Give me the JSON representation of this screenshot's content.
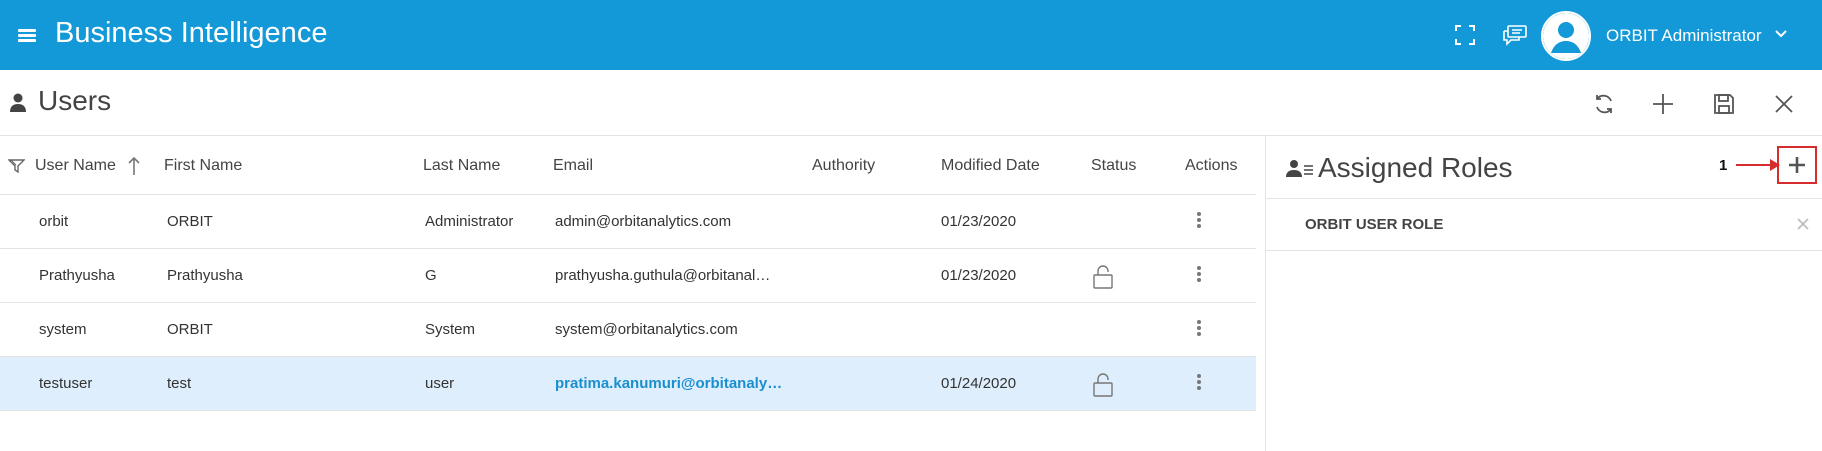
{
  "app": {
    "title": "Business Intelligence",
    "brand_color": "#1398d8",
    "user_name": "ORBIT Administrator"
  },
  "page": {
    "title": "Users",
    "actions": [
      "refresh-icon",
      "plus-icon",
      "save-icon",
      "close-icon"
    ]
  },
  "table": {
    "columns": [
      "User Name",
      "First Name",
      "Last Name",
      "Email",
      "Authority",
      "Modified Date",
      "Status",
      "Actions"
    ],
    "rows": [
      {
        "user_name": "orbit",
        "first_name": "ORBIT",
        "last_name": "Administrator",
        "email": "admin@orbitanalytics.com",
        "authority": "",
        "modified": "01/23/2020",
        "locked": false
      },
      {
        "user_name": "Prathyusha",
        "first_name": "Prathyusha",
        "last_name": "G",
        "email": "prathyusha.guthula@orbitanal…",
        "authority": "",
        "modified": "01/23/2020",
        "locked": true
      },
      {
        "user_name": "system",
        "first_name": "ORBIT",
        "last_name": "System",
        "email": "system@orbitanalytics.com",
        "authority": "",
        "modified": "",
        "locked": false
      },
      {
        "user_name": "testuser",
        "first_name": "test",
        "last_name": "user",
        "email": "pratima.kanumuri@orbitanalyt…",
        "authority": "",
        "modified": "01/24/2020",
        "locked": true,
        "selected": true
      }
    ],
    "selected_row_color": "#deeefc",
    "link_color": "#1a8fd0"
  },
  "roles": {
    "title": "Assigned Roles",
    "annotation_number": "1",
    "annotation_color": "#d62c2c",
    "items": [
      "ORBIT USER ROLE"
    ]
  }
}
